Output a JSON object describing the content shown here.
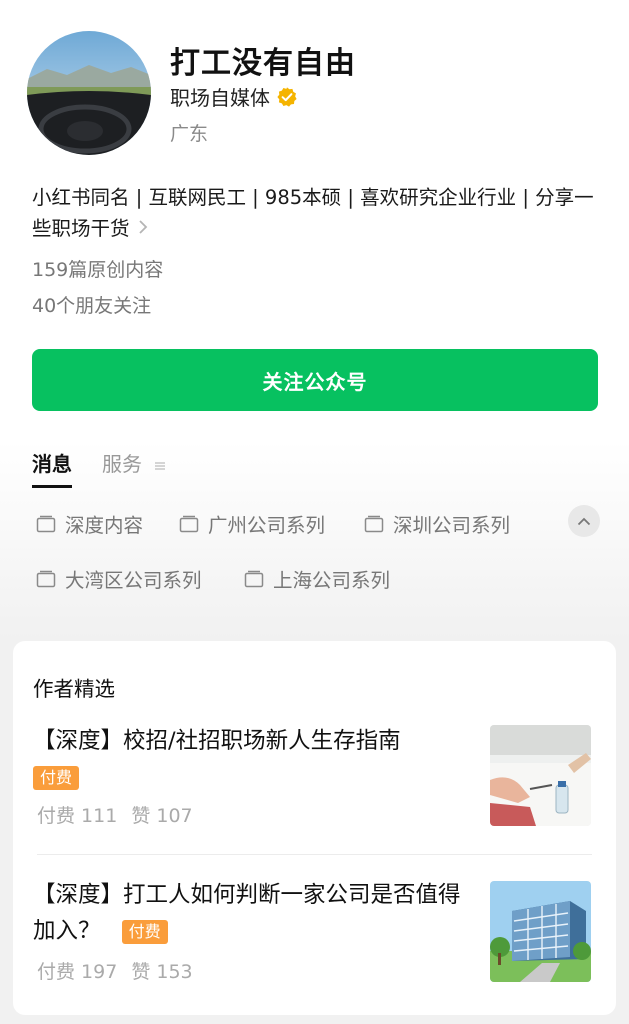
{
  "profile": {
    "name": "打工没有自由",
    "org": "职场自媒体",
    "region": "广东",
    "bio": "小红书同名 | 互联网民工 | 985本硕 | 喜欢研究企业行业 | 分享一些职场干货",
    "original_count": "159篇原创内容",
    "friends_following": "40个朋友关注"
  },
  "follow_button": {
    "label": "关注公众号",
    "color": "#07c160"
  },
  "tabs": [
    {
      "label": "消息",
      "active": true
    },
    {
      "label": "服务",
      "active": false
    }
  ],
  "categories": [
    "深度内容",
    "广州公司系列",
    "深圳公司系列",
    "大湾区公司系列",
    "上海公司系列"
  ],
  "featured": {
    "title": "作者精选",
    "articles": [
      {
        "title": "【深度】校招/社招职场新人生存指南",
        "badge": "付费",
        "paid_label": "付费 111",
        "likes_label": "赞 107"
      },
      {
        "title": "【深度】打工人如何判断一家公司是否值得加入？",
        "badge": "付费",
        "paid_label": "付费 197",
        "likes_label": "赞 153"
      }
    ]
  },
  "colors": {
    "accent": "#07c160",
    "badge": "#fa9d3b",
    "verified": "#f5b400"
  }
}
